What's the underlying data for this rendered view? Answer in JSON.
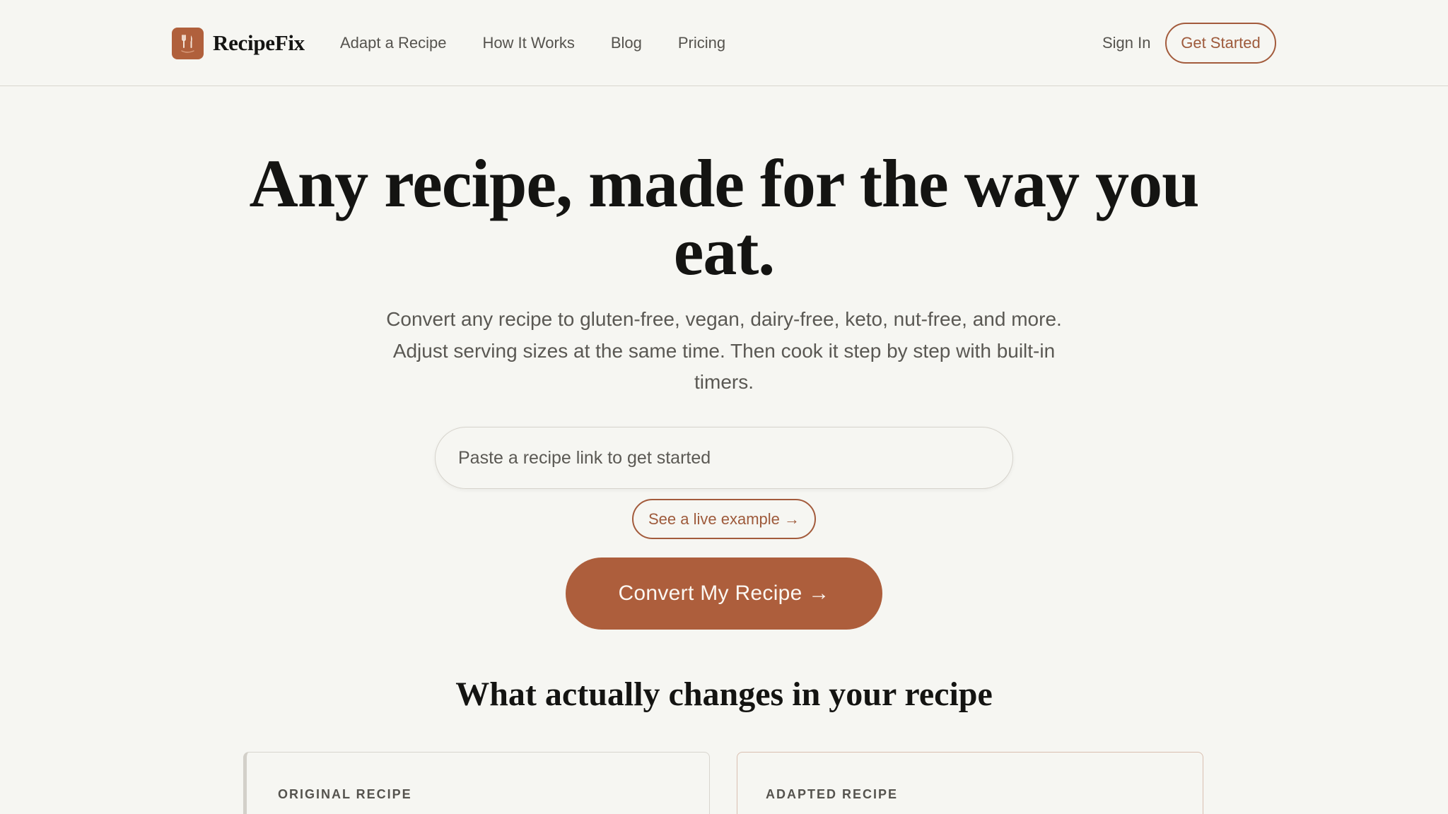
{
  "brand": {
    "name": "RecipeFix",
    "logo_icon": "fork-knife-icon",
    "accent_color": "#ad5e3c"
  },
  "nav": {
    "links": [
      "Adapt a Recipe",
      "How It Works",
      "Blog",
      "Pricing"
    ],
    "sign_in": "Sign In",
    "get_started": "Get Started"
  },
  "hero": {
    "title": "Any recipe, made for the way you eat.",
    "subtitle": "Convert any recipe to gluten-free, vegan, dairy-free, keto, nut-free, and more. Adjust serving sizes at the same time. Then cook it step by step with built-in timers.",
    "url_input": {
      "value": "",
      "placeholder": "Paste a recipe link to get started"
    },
    "example_link": "See a live example →",
    "convert_button": "Convert My Recipe →"
  },
  "comparison": {
    "title": "What actually changes in your recipe",
    "original_label": "ORIGINAL RECIPE",
    "adapted_label": "ADAPTED RECIPE"
  }
}
